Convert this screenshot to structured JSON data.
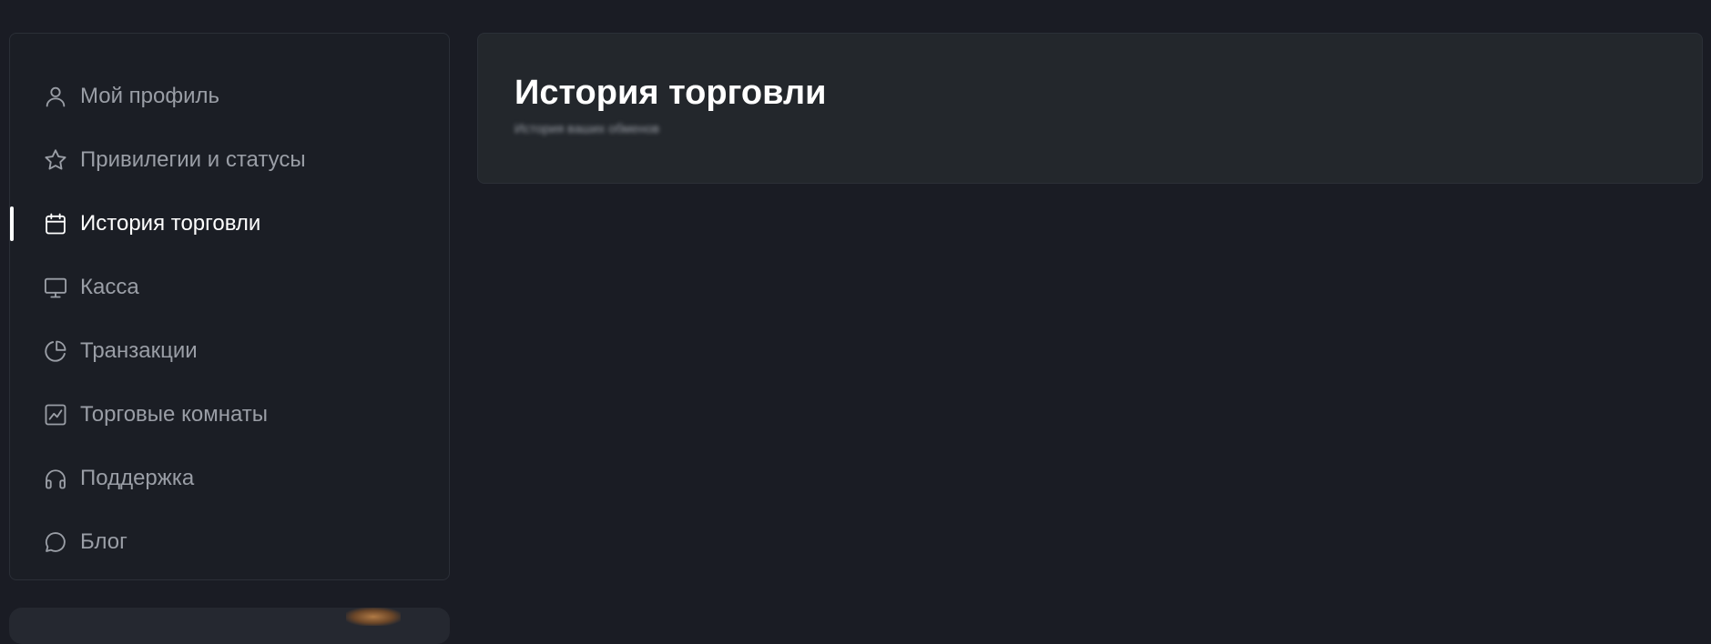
{
  "sidebar": {
    "items": [
      {
        "label": "Мой профиль",
        "icon": "user-icon",
        "active": false
      },
      {
        "label": "Привилегии и статусы",
        "icon": "star-icon",
        "active": false
      },
      {
        "label": "История торговли",
        "icon": "calendar-icon",
        "active": true
      },
      {
        "label": "Касса",
        "icon": "monitor-icon",
        "active": false
      },
      {
        "label": "Транзакции",
        "icon": "pie-chart-icon",
        "active": false
      },
      {
        "label": "Торговые комнаты",
        "icon": "trend-chart-icon",
        "active": false
      },
      {
        "label": "Поддержка",
        "icon": "headphones-icon",
        "active": false
      },
      {
        "label": "Блог",
        "icon": "chat-bubble-icon",
        "active": false
      }
    ]
  },
  "header": {
    "title": "История торговли",
    "subtitle": "История ваших обменов"
  },
  "colors": {
    "background": "#1a1c24",
    "card": "#23272c",
    "text_muted": "#9a9ea6",
    "text_active": "#ffffff"
  }
}
